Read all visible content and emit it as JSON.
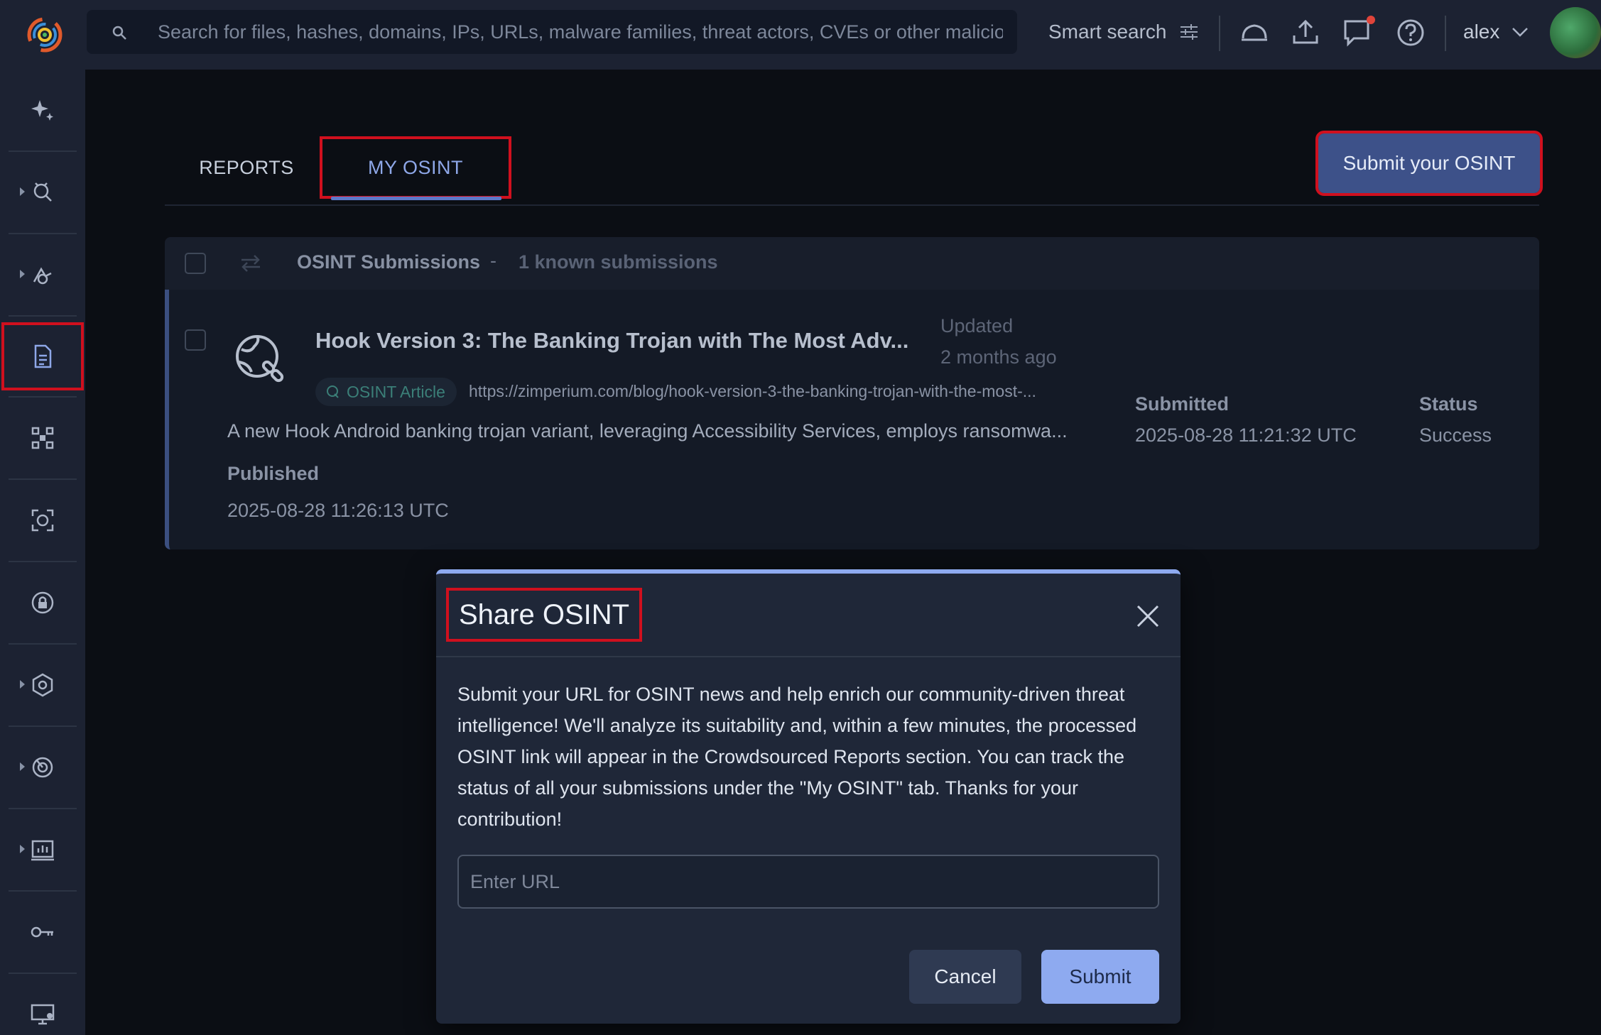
{
  "topbar": {
    "search_placeholder": "Search for files, hashes, domains, IPs, URLs, malware families, threat actors, CVEs or other malicio",
    "smart_search_label": "Smart search",
    "username": "alex",
    "icons": [
      "logo-icon",
      "search-icon",
      "filter-sliders-icon",
      "cloud-icon",
      "upload-icon",
      "chat-icon",
      "help-icon",
      "chevron-down-icon"
    ]
  },
  "sidebar": {
    "items": [
      {
        "icon": "sparkle-icon",
        "expandable": false
      },
      {
        "icon": "threat-hunting-icon",
        "expandable": true
      },
      {
        "icon": "detection-icon",
        "expandable": true
      },
      {
        "icon": "document-icon",
        "expandable": false,
        "active": true
      },
      {
        "icon": "graph-icon",
        "expandable": false
      },
      {
        "icon": "scan-icon",
        "expandable": false
      },
      {
        "icon": "lock-icon",
        "expandable": false
      },
      {
        "icon": "hexagon-icon",
        "expandable": true
      },
      {
        "icon": "radar-icon",
        "expandable": true
      },
      {
        "icon": "chart-icon",
        "expandable": true
      },
      {
        "icon": "key-icon",
        "expandable": false
      },
      {
        "icon": "monitor-icon",
        "expandable": false
      }
    ]
  },
  "tabs": {
    "reports": "REPORTS",
    "my_osint": "MY OSINT"
  },
  "submit_osint_label": "Submit your OSINT",
  "list": {
    "title": "OSINT Submissions",
    "separator": "-",
    "count": "1 known submissions",
    "rows": [
      {
        "title": "Hook Version 3: The Banking Trojan with The Most Adv...",
        "updated_label": "Updated",
        "updated_value": "2 months ago",
        "tag": "OSINT Article",
        "url": "https://zimperium.com/blog/hook-version-3-the-banking-trojan-with-the-most-...",
        "description": "A new Hook Android banking trojan variant, leveraging Accessibility Services, employs ransomwa...",
        "published_label": "Published",
        "published_value": "2025-08-28 11:26:13 UTC",
        "submitted_label": "Submitted",
        "submitted_value": "2025-08-28 11:21:32 UTC",
        "status_label": "Status",
        "status_value": "Success"
      }
    ]
  },
  "modal": {
    "title": "Share OSINT",
    "body": "Submit your URL for OSINT news and help enrich our community-driven threat intelligence! We'll analyze its suitability and, within a few minutes, the processed OSINT link will appear in the Crowdsourced Reports section. You can track the status of all your submissions under the \"My OSINT\" tab. Thanks for your contribution!",
    "url_placeholder": "Enter URL",
    "url_value": "",
    "cancel_label": "Cancel",
    "submit_label": "Submit"
  },
  "colors": {
    "accent": "#8eaaf0",
    "highlight_box": "#d0101e",
    "tag_text": "#3b7f78"
  }
}
